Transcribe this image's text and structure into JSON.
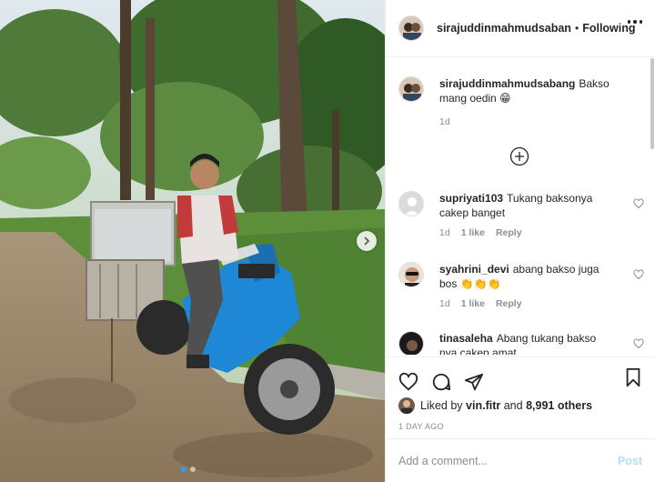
{
  "post_header": {
    "username": "sirajuddinmahmudsabang",
    "separator": "•",
    "follow_status": "Following"
  },
  "caption": {
    "username": "sirajuddinmahmudsabang",
    "text": "Bakso mang oedin 😁",
    "time": "1d"
  },
  "comments": [
    {
      "username": "supriyati103",
      "text": "Tukang baksonya cakep banget",
      "time": "1d",
      "likes": "1 like",
      "reply": "Reply"
    },
    {
      "username": "syahrini_devi",
      "text": "abang bakso juga bos 👏👏👏",
      "time": "1d",
      "likes": "1 like",
      "reply": "Reply"
    },
    {
      "username": "tinasaleha",
      "text": "Abang tukang bakso nya cakep amat",
      "time": "",
      "likes": "",
      "reply": ""
    }
  ],
  "likes": {
    "prefix": "Liked by",
    "user": "vin.fitr",
    "connector": "and",
    "others": "8,991 others"
  },
  "date": "1 DAY AGO",
  "add_comment": {
    "placeholder": "Add a comment...",
    "post_label": "Post"
  },
  "icons": [
    "heart-icon",
    "comment-icon",
    "share-icon",
    "save-icon",
    "more-icon",
    "plus-circle-icon",
    "chevron-right-icon"
  ],
  "colors": {
    "link_blue": "#3897f0",
    "post_disabled": "#b2dffc",
    "muted": "#8e8e8e",
    "motorbike_blue": "#1e88d6"
  }
}
